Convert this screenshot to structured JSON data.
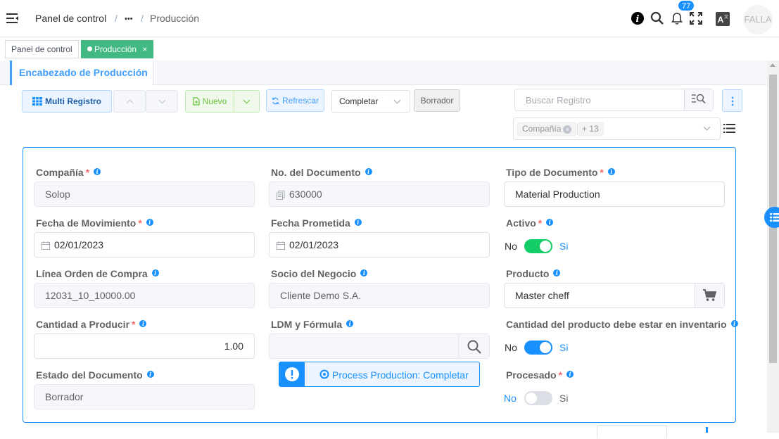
{
  "header": {
    "breadcrumb": [
      "Panel de control",
      "/",
      "•••",
      "/",
      "Producción"
    ],
    "notification_count": "77",
    "avatar_text": "FALLA",
    "icons": [
      "menu-fold-icon",
      "info-icon",
      "search-icon",
      "bell-icon",
      "fullscreen-icon",
      "translate-icon"
    ]
  },
  "tags_view": {
    "tags": [
      {
        "label": "Panel de control",
        "active": false
      },
      {
        "label": "Producción",
        "active": true,
        "close": "×"
      }
    ]
  },
  "tab": {
    "label": "Encabezado de Producción"
  },
  "toolbar": {
    "multi_record": "Multi Registro",
    "new": "Nuevo",
    "refresh": "Refrescar",
    "action_select": "Completar",
    "draft": "Borrador"
  },
  "search": {
    "placeholder": "Buscar Registro"
  },
  "filters": {
    "chips": [
      "Compañía",
      "+ 13"
    ]
  },
  "form": {
    "company": {
      "label": "Compañía",
      "value": "Solop"
    },
    "document_no": {
      "label": "No. del Documento",
      "value": "630000"
    },
    "doc_type": {
      "label": "Tipo de Documento",
      "value": "Material Production"
    },
    "movement_date": {
      "label": "Fecha de Movimiento",
      "value": "02/01/2023"
    },
    "date_promised": {
      "label": "Fecha Prometida",
      "value": "02/01/2023"
    },
    "active": {
      "label": "Activo",
      "off": "No",
      "on": "Si",
      "state": true
    },
    "order_line": {
      "label": "Línea Orden de Compra",
      "value": "12031_10_10000.00"
    },
    "business_partner": {
      "label": "Socio del Negocio",
      "value": "Cliente Demo S.A."
    },
    "product": {
      "label": "Producto",
      "value": "Master cheff"
    },
    "qty": {
      "label": "Cantidad a Producir",
      "value": "1.00"
    },
    "bom": {
      "label": "LDM y Fórmula",
      "value": ""
    },
    "in_stock": {
      "label": "Cantidad del producto debe estar en inventario",
      "off": "No",
      "on": "Si",
      "state": true
    },
    "doc_status": {
      "label": "Estado del Documento",
      "value": "Borrador"
    },
    "processed": {
      "label": "Procesado",
      "off": "No",
      "on": "Si",
      "state": false
    },
    "process_button": "Process Production: Completar"
  },
  "colors": {
    "primary": "#1890ff",
    "success": "#13ce66",
    "tag_active": "#42b983"
  }
}
